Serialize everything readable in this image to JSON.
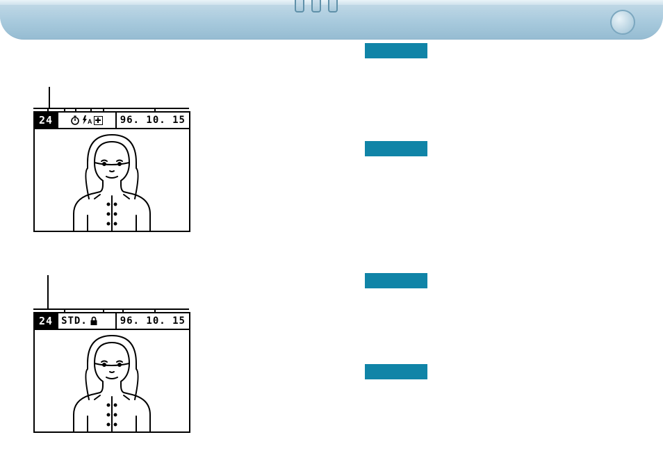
{
  "screens": {
    "record": {
      "frame_number": "24",
      "date": "96. 10. 15"
    },
    "play": {
      "frame_number": "24",
      "quality": "STD.",
      "date": "96. 10. 15"
    }
  }
}
